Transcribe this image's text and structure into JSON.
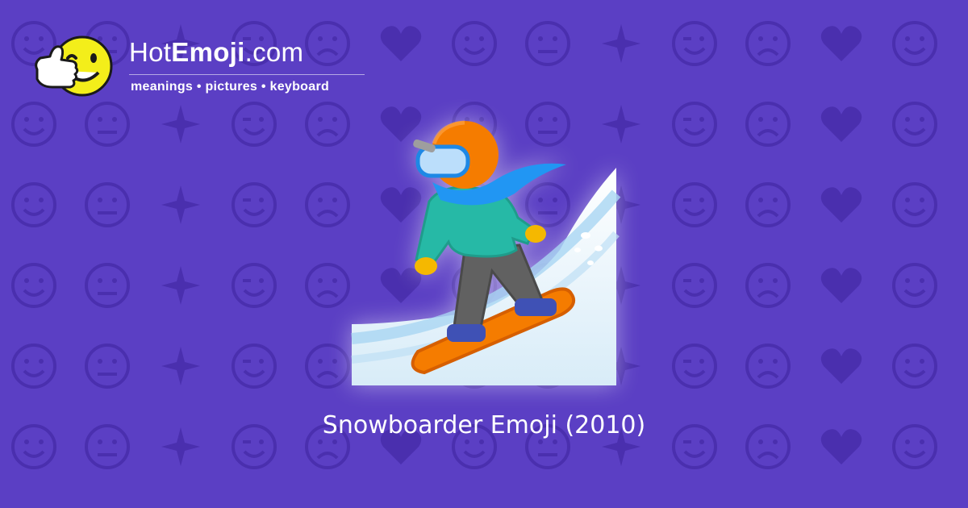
{
  "site": {
    "name_prefix": "Hot",
    "name_bold": "Emoji",
    "name_suffix": ".com",
    "tagline": "meanings • pictures • keyboard"
  },
  "hero": {
    "emoji_name": "snowboarder-emoji"
  },
  "caption": "Snowboarder Emoji (2010)",
  "colors": {
    "background": "#5b3fc4",
    "pattern": "#4a2fae",
    "logo_face": "#f3ee1a"
  }
}
